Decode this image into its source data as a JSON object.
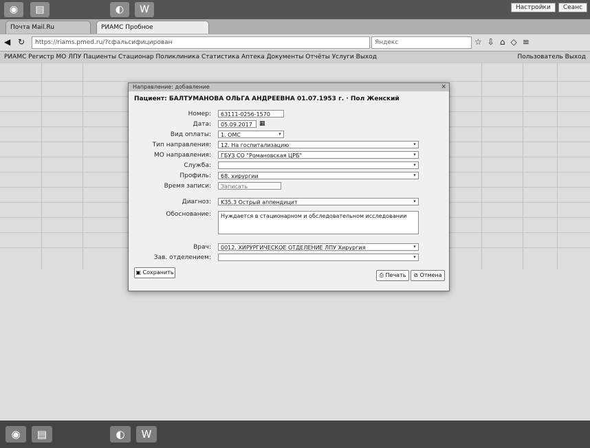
{
  "taskbar_top": {
    "icons": [
      "win-logo-icon",
      "folder-icon",
      "browser-icon",
      "word-icon"
    ],
    "right_buttons": [
      "Настройки",
      "Сеанс"
    ]
  },
  "tabs": [
    {
      "label": "Почта Mail.Ru"
    },
    {
      "label": "РИАМС Пробное"
    }
  ],
  "address": {
    "url": "https://riams.pmed.ru/?сфальсифицирован",
    "search_placeholder": "Яндекс"
  },
  "menubar": {
    "text": "РИАМС   Регистр МО   ЛПУ   Пациенты   Стационар   Поликлиника   Статистика   Аптека   Документы   Отчёты   Услуги   Выход",
    "user": "Пользователь   Выход"
  },
  "modal": {
    "window_title": "Направление: добавление",
    "heading": "Пациент: БАЛТУМАНОВА ОЛЬГА АНДРЕЕВНА 01.07.1953 г. · Пол Женский",
    "fields": [
      {
        "label": "Номер:",
        "value": "63111-0256-1570"
      },
      {
        "label": "Дата:",
        "value": "05.09.2017"
      },
      {
        "label": "Вид оплаты:",
        "value": "1. ОМС"
      },
      {
        "label": "Тип направления:",
        "value": "12. На госпитализацию"
      },
      {
        "label": "МО направления:",
        "value": "ГБУЗ СО \"Романовская ЦРБ\""
      },
      {
        "label": "Служба:",
        "value": ""
      },
      {
        "label": "Профиль:",
        "value": "68. хирургии"
      },
      {
        "label": "Время записи:",
        "value": "Записать"
      },
      {
        "label": "Диагноз:",
        "value": "K35.3 Острый аппендицит"
      },
      {
        "label": "Обоснование:",
        "value": "Нуждается в стационарном и обследовательном исследовании"
      },
      {
        "label": "Врач:",
        "value": "0012. ХИРУРГИЧЕСКОЕ ОТДЕЛЕНИЕ ЛПУ Хирургия"
      },
      {
        "label": "Зав. отделением:",
        "value": ""
      }
    ],
    "save_label": "Сохранить",
    "print_label": "Печать",
    "cancel_label": "Отмена"
  },
  "taskbar_bottom": {
    "icons": [
      "win-logo-icon",
      "folder-icon",
      "browser-icon",
      "word-icon"
    ]
  }
}
